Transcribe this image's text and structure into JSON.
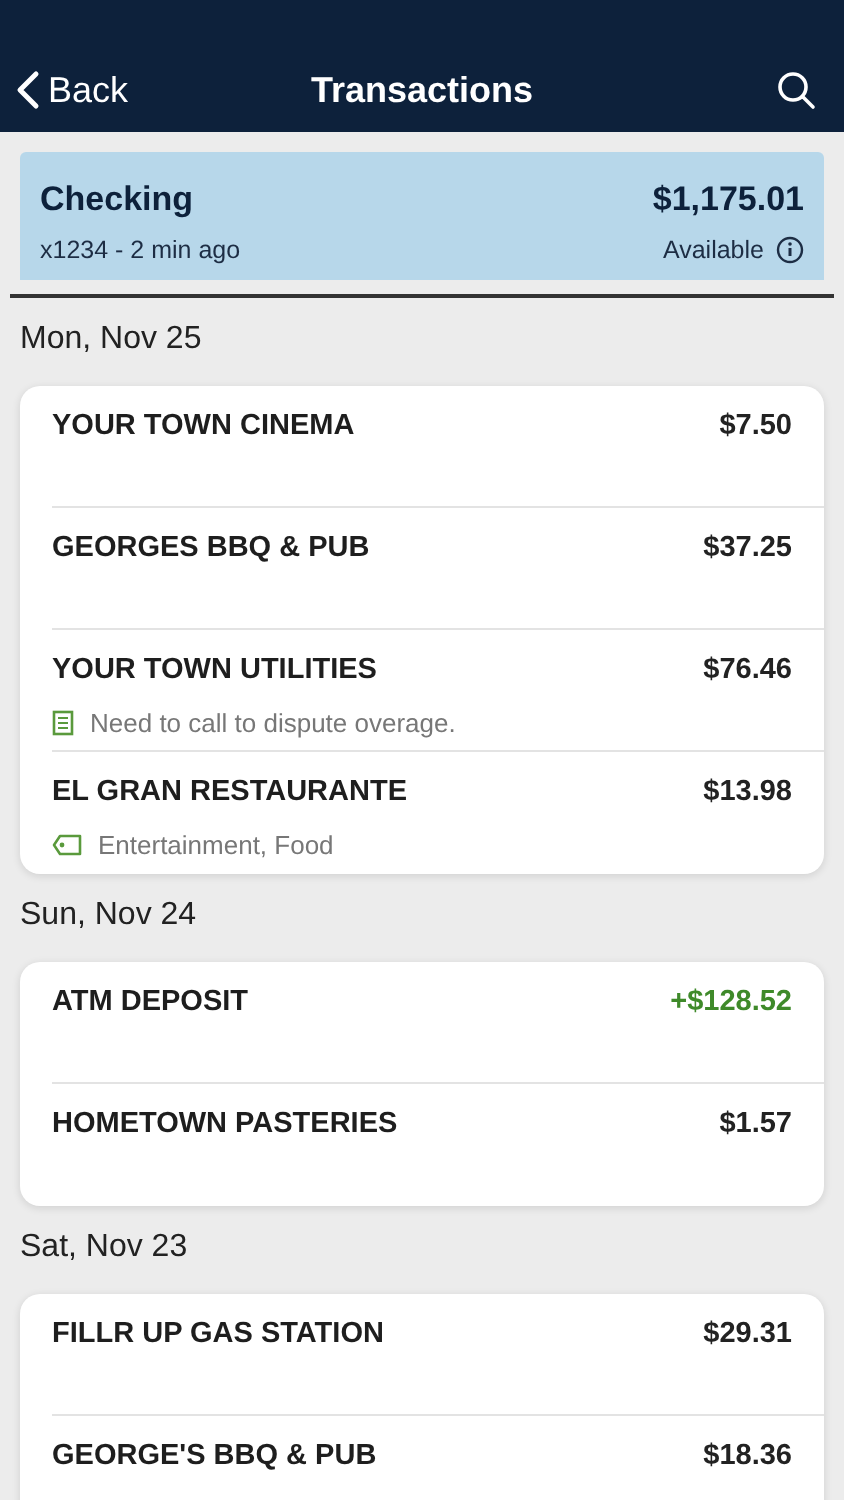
{
  "header": {
    "back": "Back",
    "title": "Transactions"
  },
  "account": {
    "name": "Checking",
    "subtitle": "x1234 - 2 min ago",
    "balance": "$1,175.01",
    "balance_label": "Available"
  },
  "days": [
    {
      "date": "Mon, Nov 25",
      "transactions": [
        {
          "name": "YOUR TOWN CINEMA",
          "amount": "$7.50",
          "kind": "debit"
        },
        {
          "name": "GEORGES BBQ & PUB",
          "amount": "$37.25",
          "kind": "debit"
        },
        {
          "name": "YOUR TOWN UTILITIES",
          "amount": "$76.46",
          "kind": "debit",
          "detail": {
            "kind": "note",
            "text": "Need to call to dispute overage."
          }
        },
        {
          "name": "EL GRAN RESTAURANTE",
          "amount": "$13.98",
          "kind": "debit",
          "detail": {
            "kind": "tags",
            "text": "Entertainment, Food"
          }
        }
      ]
    },
    {
      "date": "Sun, Nov 24",
      "transactions": [
        {
          "name": "ATM DEPOSIT",
          "amount": "+$128.52",
          "kind": "credit"
        },
        {
          "name": "HOMETOWN PASTERIES",
          "amount": "$1.57",
          "kind": "debit"
        }
      ]
    },
    {
      "date": "Sat, Nov 23",
      "transactions": [
        {
          "name": "FILLR UP GAS STATION",
          "amount": "$29.31",
          "kind": "debit"
        },
        {
          "name": "GEORGE'S BBQ & PUB",
          "amount": "$18.36",
          "kind": "debit"
        }
      ]
    }
  ]
}
